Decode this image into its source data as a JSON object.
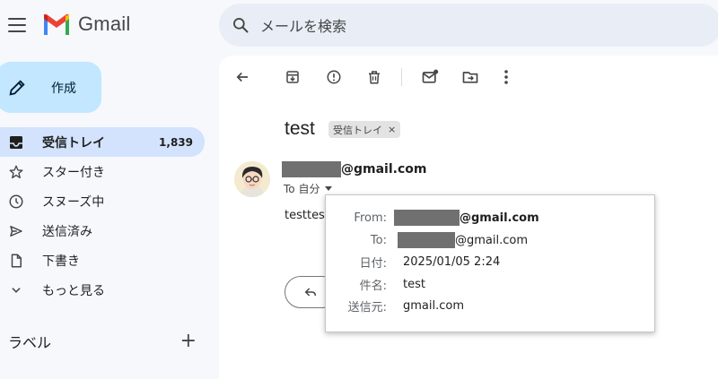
{
  "header": {
    "app_name": "Gmail",
    "search_placeholder": "メールを検索"
  },
  "sidebar": {
    "compose_label": "作成",
    "items": [
      {
        "label": "受信トレイ",
        "count": "1,839",
        "icon": "inbox-icon",
        "active": true
      },
      {
        "label": "スター付き",
        "count": "",
        "icon": "star-icon"
      },
      {
        "label": "スヌーズ中",
        "count": "",
        "icon": "clock-icon"
      },
      {
        "label": "送信済み",
        "count": "",
        "icon": "send-icon"
      },
      {
        "label": "下書き",
        "count": "",
        "icon": "draft-icon"
      },
      {
        "label": "もっと見る",
        "count": "",
        "icon": "chevron-down-icon"
      }
    ],
    "labels_title": "ラベル",
    "labels_add": "+"
  },
  "email": {
    "subject": "test",
    "label_chip": "受信トレイ",
    "label_chip_remove": "×",
    "sender_domain": "@gmail.com",
    "to_line": "To 自分",
    "body": "testtest"
  },
  "details_popup": {
    "from_key": "From:",
    "from_domain": "@gmail.com",
    "to_key": "To:",
    "to_domain": "@gmail.com",
    "date_key": "日付:",
    "date_value": "2025/01/05 2:24",
    "subject_key": "件名:",
    "subject_value": "test",
    "mailed_by_key": "送信元:",
    "mailed_by_value": "gmail.com"
  },
  "colors": {
    "compose_bg": "#c2e7ff",
    "active_nav_bg": "#d3e3fd",
    "search_bg": "#e9eef6",
    "page_bg": "#f6f8fc",
    "redaction": "#707070"
  }
}
